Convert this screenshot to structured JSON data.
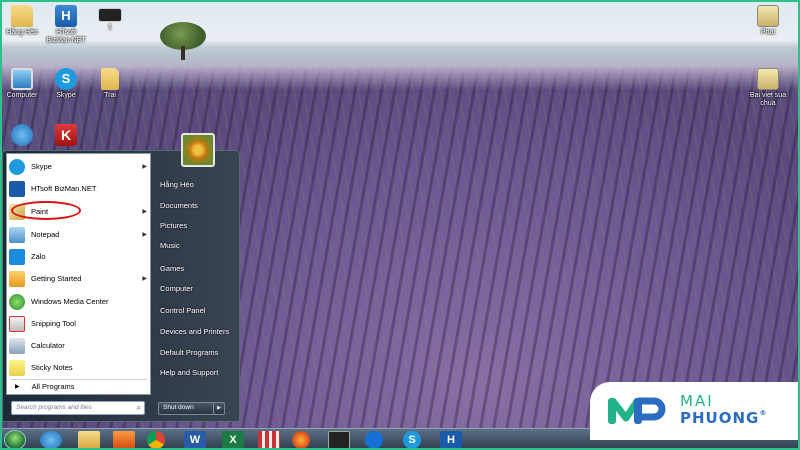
{
  "desktop": {
    "icons": [
      {
        "label": "Hằng Héo",
        "icon": "user-folder-icon"
      },
      {
        "label": "HTsoft BizMan.NET",
        "icon": "bizman-icon",
        "glyph": "H"
      },
      {
        "label": "1",
        "icon": "shortcut-icon"
      },
      {
        "label": "Computer",
        "icon": "computer-icon"
      },
      {
        "label": "Skype",
        "icon": "skype-icon",
        "glyph": "S"
      },
      {
        "label": "Trai",
        "icon": "folder-icon"
      },
      {
        "label": "Phai",
        "icon": "winrar-icon"
      },
      {
        "label": "Bai viet sua chua",
        "icon": "winrar-icon"
      },
      {
        "label": "",
        "icon": "internet-explorer-icon"
      },
      {
        "label": "",
        "icon": "kaspersky-icon",
        "glyph": "K"
      }
    ]
  },
  "start_menu": {
    "programs": [
      {
        "label": "Skype",
        "has_submenu": true
      },
      {
        "label": "HTsoft BizMan.NET",
        "has_submenu": false
      },
      {
        "label": "Paint",
        "has_submenu": true,
        "highlighted": true
      },
      {
        "label": "Notepad",
        "has_submenu": true
      },
      {
        "label": "Zalo",
        "has_submenu": false
      },
      {
        "label": "Getting Started",
        "has_submenu": true
      },
      {
        "label": "Windows Media Center",
        "has_submenu": false
      },
      {
        "label": "Snipping Tool",
        "has_submenu": false
      },
      {
        "label": "Calculator",
        "has_submenu": false
      },
      {
        "label": "Sticky Notes",
        "has_submenu": false
      }
    ],
    "all_programs": "All Programs",
    "search_placeholder": "Search programs and files",
    "right_items": [
      "Hằng Héo",
      "Documents",
      "Pictures",
      "Music",
      "Games",
      "Computer",
      "Control Panel",
      "Devices and Printers",
      "Default Programs",
      "Help and Support"
    ],
    "shutdown_label": "Shut down",
    "submenu_arrow": "▶"
  },
  "taskbar": {
    "items": [
      {
        "name": "internet-explorer"
      },
      {
        "name": "windows-explorer"
      },
      {
        "name": "media-player"
      },
      {
        "name": "chrome"
      },
      {
        "name": "word",
        "glyph": "W"
      },
      {
        "name": "excel",
        "glyph": "X"
      },
      {
        "name": "app-grid"
      },
      {
        "name": "firefox"
      },
      {
        "name": "console"
      },
      {
        "name": "teamviewer"
      },
      {
        "name": "skype",
        "glyph": "S"
      },
      {
        "name": "bizman",
        "glyph": "H"
      }
    ]
  },
  "watermark": {
    "line1": "MAI",
    "line2": "PHUONG",
    "registered": "®",
    "colors": {
      "green": "#21b38a",
      "blue": "#2a6cc2"
    }
  },
  "accent_colors": {
    "frame": "#2cc08b",
    "highlight_circle": "#dd1111"
  }
}
